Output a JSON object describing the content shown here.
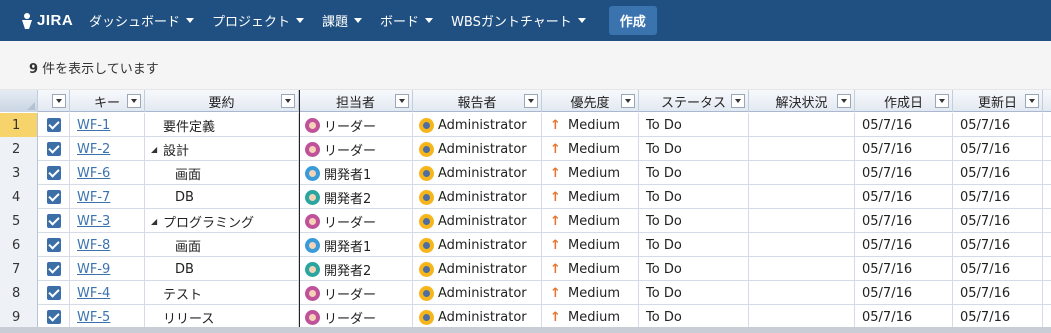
{
  "nav": {
    "logo_text": "JIRA",
    "items": [
      "ダッシュボード",
      "プロジェクト",
      "課題",
      "ボード",
      "WBSガントチャート"
    ],
    "create_label": "作成"
  },
  "info": {
    "count": "9",
    "suffix": " 件を表示しています"
  },
  "columns": [
    "キー",
    "要約",
    "担当者",
    "報告者",
    "優先度",
    "ステータス",
    "解決状況",
    "作成日",
    "更新日"
  ],
  "rows": [
    {
      "num": "1",
      "key": "WF-1",
      "tw": "",
      "summary": "要件定義",
      "assignee": "リーダー",
      "reporter": "Administrator",
      "priority": "Medium",
      "status": "To Do",
      "resolution": "",
      "created": "05/7/16",
      "updated": "05/7/16"
    },
    {
      "num": "2",
      "key": "WF-2",
      "tw": "◢",
      "summary": "設計",
      "assignee": "リーダー",
      "reporter": "Administrator",
      "priority": "Medium",
      "status": "To Do",
      "resolution": "",
      "created": "05/7/16",
      "updated": "05/7/16"
    },
    {
      "num": "3",
      "key": "WF-6",
      "tw": "",
      "summary": "画面",
      "assignee": "開発者1",
      "reporter": "Administrator",
      "priority": "Medium",
      "status": "To Do",
      "resolution": "",
      "created": "05/7/16",
      "updated": "05/7/16"
    },
    {
      "num": "4",
      "key": "WF-7",
      "tw": "",
      "summary": "DB",
      "assignee": "開発者2",
      "reporter": "Administrator",
      "priority": "Medium",
      "status": "To Do",
      "resolution": "",
      "created": "05/7/16",
      "updated": "05/7/16"
    },
    {
      "num": "5",
      "key": "WF-3",
      "tw": "◢",
      "summary": "プログラミング",
      "assignee": "リーダー",
      "reporter": "Administrator",
      "priority": "Medium",
      "status": "To Do",
      "resolution": "",
      "created": "05/7/16",
      "updated": "05/7/16"
    },
    {
      "num": "6",
      "key": "WF-8",
      "tw": "",
      "summary": "画面",
      "assignee": "開発者1",
      "reporter": "Administrator",
      "priority": "Medium",
      "status": "To Do",
      "resolution": "",
      "created": "05/7/16",
      "updated": "05/7/16"
    },
    {
      "num": "7",
      "key": "WF-9",
      "tw": "",
      "summary": "DB",
      "assignee": "開発者2",
      "reporter": "Administrator",
      "priority": "Medium",
      "status": "To Do",
      "resolution": "",
      "created": "05/7/16",
      "updated": "05/7/16"
    },
    {
      "num": "8",
      "key": "WF-4",
      "tw": "",
      "summary": "テスト",
      "assignee": "リーダー",
      "reporter": "Administrator",
      "priority": "Medium",
      "status": "To Do",
      "resolution": "",
      "created": "05/7/16",
      "updated": "05/7/16"
    },
    {
      "num": "9",
      "key": "WF-5",
      "tw": "",
      "summary": "リリース",
      "assignee": "リーダー",
      "reporter": "Administrator",
      "priority": "Medium",
      "status": "To Do",
      "resolution": "",
      "created": "05/7/16",
      "updated": "05/7/16"
    }
  ],
  "colors": {
    "topbar": "#205081",
    "create_button": "#3b73af",
    "link": "#3b73af",
    "priority_arrow": "#e8742a",
    "selected_row_header": "#f7d36b"
  },
  "icons": {
    "logo": "jira-logo-icon",
    "priority_medium": "arrow-up-icon",
    "checkbox": "checkbox-checked-icon"
  }
}
